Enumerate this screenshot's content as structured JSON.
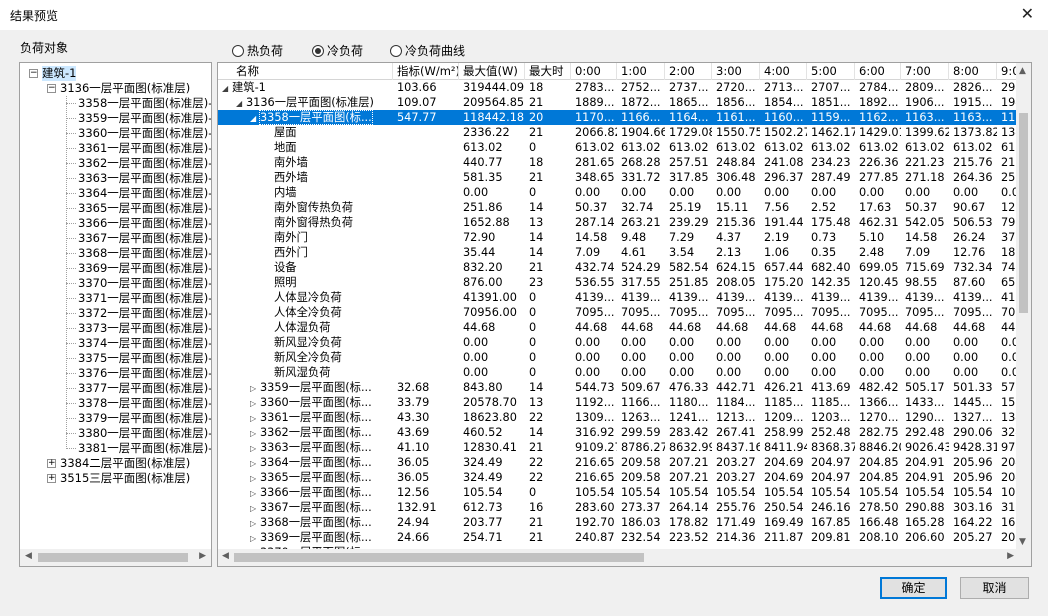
{
  "window": {
    "title": "结果预览"
  },
  "left_panel_label": "负荷对象",
  "tree": {
    "root": "建筑-1",
    "building": "3136一层平面图(标准层)",
    "floors": [
      "3358一层平面图(标准层)-2",
      "3359一层平面图(标准层)-3",
      "3360一层平面图(标准层)-4",
      "3361一层平面图(标准层)-5",
      "3362一层平面图(标准层)-6",
      "3363一层平面图(标准层)-7",
      "3364一层平面图(标准层)-8",
      "3365一层平面图(标准层)-9",
      "3366一层平面图(标准层)-10",
      "3367一层平面图(标准层)-11",
      "3368一层平面图(标准层)-12",
      "3369一层平面图(标准层)-13",
      "3370一层平面图(标准层)-14",
      "3371一层平面图(标准层)-15",
      "3372一层平面图(标准层)-16",
      "3373一层平面图(标准层)-17",
      "3374一层平面图(标准层)-18",
      "3375一层平面图(标准层)-19",
      "3376一层平面图(标准层)-20",
      "3377一层平面图(标准层)-21",
      "3378一层平面图(标准层)-22",
      "3379一层平面图(标准层)-23",
      "3380一层平面图(标准层)-24",
      "3381一层平面图(标准层)-25"
    ],
    "others": [
      "3384二层平面图(标准层)",
      "3515三层平面图(标准层)"
    ]
  },
  "radios": [
    {
      "label": "热负荷",
      "selected": false
    },
    {
      "label": "冷负荷",
      "selected": true
    },
    {
      "label": "冷负荷曲线",
      "selected": false
    }
  ],
  "columns": [
    "名称",
    "指标(W/m²)",
    "最大值(W)",
    "最大时",
    "0:00",
    "1:00",
    "2:00",
    "3:00",
    "4:00",
    "5:00",
    "6:00",
    "7:00",
    "8:00",
    "9:0"
  ],
  "rows": [
    {
      "name": "建筑-1",
      "level": 0,
      "expander": "open",
      "cells": [
        "103.66",
        "319444.09",
        "18",
        "2783...",
        "2752...",
        "2737...",
        "2720...",
        "2713...",
        "2707...",
        "2784...",
        "2809...",
        "2826...",
        "291"
      ]
    },
    {
      "name": "3136一层平面图(标准层)",
      "level": 1,
      "expander": "open",
      "cells": [
        "109.07",
        "209564.85",
        "21",
        "1889...",
        "1872...",
        "1865...",
        "1856...",
        "1854...",
        "1851...",
        "1892...",
        "1906...",
        "1915...",
        "194"
      ]
    },
    {
      "name": "3358一层平面图(标...",
      "level": 2,
      "expander": "open",
      "selected": true,
      "cells": [
        "547.77",
        "118442.18",
        "20",
        "1170...",
        "1166...",
        "1164...",
        "1161...",
        "1160...",
        "1159...",
        "1162...",
        "1163...",
        "1163...",
        "116"
      ]
    },
    {
      "name": "屋面",
      "level": 3,
      "expander": "none",
      "cells": [
        "",
        "2336.22",
        "21",
        "2066.82",
        "1904.66",
        "1729.08",
        "1550.75",
        "1502.27",
        "1462.17",
        "1429.01",
        "1399.62",
        "1373.82",
        "134"
      ]
    },
    {
      "name": "地面",
      "level": 3,
      "expander": "none",
      "cells": [
        "",
        "613.02",
        "0",
        "613.02",
        "613.02",
        "613.02",
        "613.02",
        "613.02",
        "613.02",
        "613.02",
        "613.02",
        "613.02",
        "613"
      ]
    },
    {
      "name": "南外墙",
      "level": 3,
      "expander": "none",
      "cells": [
        "",
        "440.77",
        "18",
        "281.65",
        "268.28",
        "257.51",
        "248.84",
        "241.08",
        "234.23",
        "226.36",
        "221.23",
        "215.76",
        "211"
      ]
    },
    {
      "name": "西外墙",
      "level": 3,
      "expander": "none",
      "cells": [
        "",
        "581.35",
        "21",
        "348.65",
        "331.72",
        "317.85",
        "306.48",
        "296.37",
        "287.49",
        "277.85",
        "271.18",
        "264.36",
        "258"
      ]
    },
    {
      "name": "内墙",
      "level": 3,
      "expander": "none",
      "cells": [
        "",
        "0.00",
        "0",
        "0.00",
        "0.00",
        "0.00",
        "0.00",
        "0.00",
        "0.00",
        "0.00",
        "0.00",
        "0.00",
        "0.0"
      ]
    },
    {
      "name": "南外窗传热负荷",
      "level": 3,
      "expander": "none",
      "cells": [
        "",
        "251.86",
        "14",
        "50.37",
        "32.74",
        "25.19",
        "15.11",
        "7.56",
        "2.52",
        "17.63",
        "50.37",
        "90.67",
        "128"
      ]
    },
    {
      "name": "南外窗得热负荷",
      "level": 3,
      "expander": "none",
      "cells": [
        "",
        "1652.88",
        "13",
        "287.14",
        "263.21",
        "239.29",
        "215.36",
        "191.44",
        "175.48",
        "462.31",
        "542.05",
        "506.53",
        "799"
      ]
    },
    {
      "name": "南外门",
      "level": 3,
      "expander": "none",
      "cells": [
        "",
        "72.90",
        "14",
        "14.58",
        "9.48",
        "7.29",
        "4.37",
        "2.19",
        "0.73",
        "5.10",
        "14.58",
        "26.24",
        "37."
      ]
    },
    {
      "name": "西外门",
      "level": 3,
      "expander": "none",
      "cells": [
        "",
        "35.44",
        "14",
        "7.09",
        "4.61",
        "3.54",
        "2.13",
        "1.06",
        "0.35",
        "2.48",
        "7.09",
        "12.76",
        "18."
      ]
    },
    {
      "name": "设备",
      "level": 3,
      "expander": "none",
      "cells": [
        "",
        "832.20",
        "21",
        "432.74",
        "524.29",
        "582.54",
        "624.15",
        "657.44",
        "682.40",
        "699.05",
        "715.69",
        "732.34",
        "740"
      ]
    },
    {
      "name": "照明",
      "level": 3,
      "expander": "none",
      "cells": [
        "",
        "876.00",
        "23",
        "536.55",
        "317.55",
        "251.85",
        "208.05",
        "175.20",
        "142.35",
        "120.45",
        "98.55",
        "87.60",
        "65."
      ]
    },
    {
      "name": "人体显冷负荷",
      "level": 3,
      "expander": "none",
      "cells": [
        "",
        "41391.00",
        "0",
        "4139...",
        "4139...",
        "4139...",
        "4139...",
        "4139...",
        "4139...",
        "4139...",
        "4139...",
        "4139...",
        "413"
      ]
    },
    {
      "name": "人体全冷负荷",
      "level": 3,
      "expander": "none",
      "cells": [
        "",
        "70956.00",
        "0",
        "7095...",
        "7095...",
        "7095...",
        "7095...",
        "7095...",
        "7095...",
        "7095...",
        "7095...",
        "7095...",
        "709"
      ]
    },
    {
      "name": "人体湿负荷",
      "level": 3,
      "expander": "none",
      "cells": [
        "",
        "44.68",
        "0",
        "44.68",
        "44.68",
        "44.68",
        "44.68",
        "44.68",
        "44.68",
        "44.68",
        "44.68",
        "44.68",
        "44."
      ]
    },
    {
      "name": "新风显冷负荷",
      "level": 3,
      "expander": "none",
      "cells": [
        "",
        "0.00",
        "0",
        "0.00",
        "0.00",
        "0.00",
        "0.00",
        "0.00",
        "0.00",
        "0.00",
        "0.00",
        "0.00",
        "0.0"
      ]
    },
    {
      "name": "新风全冷负荷",
      "level": 3,
      "expander": "none",
      "cells": [
        "",
        "0.00",
        "0",
        "0.00",
        "0.00",
        "0.00",
        "0.00",
        "0.00",
        "0.00",
        "0.00",
        "0.00",
        "0.00",
        "0.0"
      ]
    },
    {
      "name": "新风湿负荷",
      "level": 3,
      "expander": "none",
      "cells": [
        "",
        "0.00",
        "0",
        "0.00",
        "0.00",
        "0.00",
        "0.00",
        "0.00",
        "0.00",
        "0.00",
        "0.00",
        "0.00",
        "0.0"
      ]
    },
    {
      "name": "3359一层平面图(标...",
      "level": 2,
      "expander": "closed",
      "cells": [
        "32.68",
        "843.80",
        "14",
        "544.73",
        "509.67",
        "476.33",
        "442.71",
        "426.21",
        "413.69",
        "482.42",
        "505.17",
        "501.33",
        "579"
      ]
    },
    {
      "name": "3360一层平面图(标...",
      "level": 2,
      "expander": "closed",
      "cells": [
        "33.79",
        "20578.70",
        "13",
        "1192...",
        "1166...",
        "1180...",
        "1184...",
        "1185...",
        "1185...",
        "1366...",
        "1433...",
        "1445...",
        "158"
      ]
    },
    {
      "name": "3361一层平面图(标...",
      "level": 2,
      "expander": "closed",
      "cells": [
        "43.30",
        "18623.80",
        "22",
        "1309...",
        "1263...",
        "1241...",
        "1213...",
        "1209...",
        "1203...",
        "1270...",
        "1290...",
        "1327...",
        "134"
      ]
    },
    {
      "name": "3362一层平面图(标...",
      "level": 2,
      "expander": "closed",
      "cells": [
        "43.69",
        "460.52",
        "14",
        "316.92",
        "299.59",
        "283.42",
        "267.41",
        "258.99",
        "252.48",
        "282.75",
        "292.48",
        "290.06",
        "324"
      ]
    },
    {
      "name": "3363一层平面图(标...",
      "level": 2,
      "expander": "closed",
      "cells": [
        "41.10",
        "12830.41",
        "21",
        "9109.27",
        "8786.27",
        "8632.99",
        "8437.16",
        "8411.94",
        "8368.37",
        "8846.20",
        "9026.43",
        "9428.31",
        "977"
      ]
    },
    {
      "name": "3364一层平面图(标...",
      "level": 2,
      "expander": "closed",
      "cells": [
        "36.05",
        "324.49",
        "22",
        "216.65",
        "209.58",
        "207.21",
        "203.27",
        "204.69",
        "204.97",
        "204.85",
        "204.91",
        "205.96",
        "204"
      ]
    },
    {
      "name": "3365一层平面图(标...",
      "level": 2,
      "expander": "closed",
      "cells": [
        "36.05",
        "324.49",
        "22",
        "216.65",
        "209.58",
        "207.21",
        "203.27",
        "204.69",
        "204.97",
        "204.85",
        "204.91",
        "205.96",
        "204"
      ]
    },
    {
      "name": "3366一层平面图(标...",
      "level": 2,
      "expander": "closed",
      "cells": [
        "12.56",
        "105.54",
        "0",
        "105.54",
        "105.54",
        "105.54",
        "105.54",
        "105.54",
        "105.54",
        "105.54",
        "105.54",
        "105.54",
        "105"
      ]
    },
    {
      "name": "3367一层平面图(标...",
      "level": 2,
      "expander": "closed",
      "cells": [
        "132.91",
        "612.73",
        "16",
        "283.60",
        "273.37",
        "264.14",
        "255.76",
        "250.54",
        "246.16",
        "278.50",
        "290.88",
        "303.16",
        "317"
      ]
    },
    {
      "name": "3368一层平面图(标...",
      "level": 2,
      "expander": "closed",
      "cells": [
        "24.94",
        "203.77",
        "21",
        "192.70",
        "186.03",
        "178.82",
        "171.49",
        "169.49",
        "167.85",
        "166.48",
        "165.28",
        "164.22",
        "163"
      ]
    },
    {
      "name": "3369一层平面图(标...",
      "level": 2,
      "expander": "closed",
      "cells": [
        "24.66",
        "254.71",
        "21",
        "240.87",
        "232.54",
        "223.52",
        "214.36",
        "211.87",
        "209.81",
        "208.10",
        "206.60",
        "205.27",
        "203"
      ]
    },
    {
      "name": "3370一层平面图(标...",
      "level": 2,
      "expander": "closed",
      "cells": [
        "",
        "",
        "",
        "",
        "",
        "",
        "",
        "",
        "",
        "",
        "",
        "",
        ""
      ]
    }
  ],
  "buttons": {
    "ok": "确定",
    "cancel": "取消"
  },
  "colors": {
    "selection": "#0078d7",
    "accent": "#0078d7"
  }
}
